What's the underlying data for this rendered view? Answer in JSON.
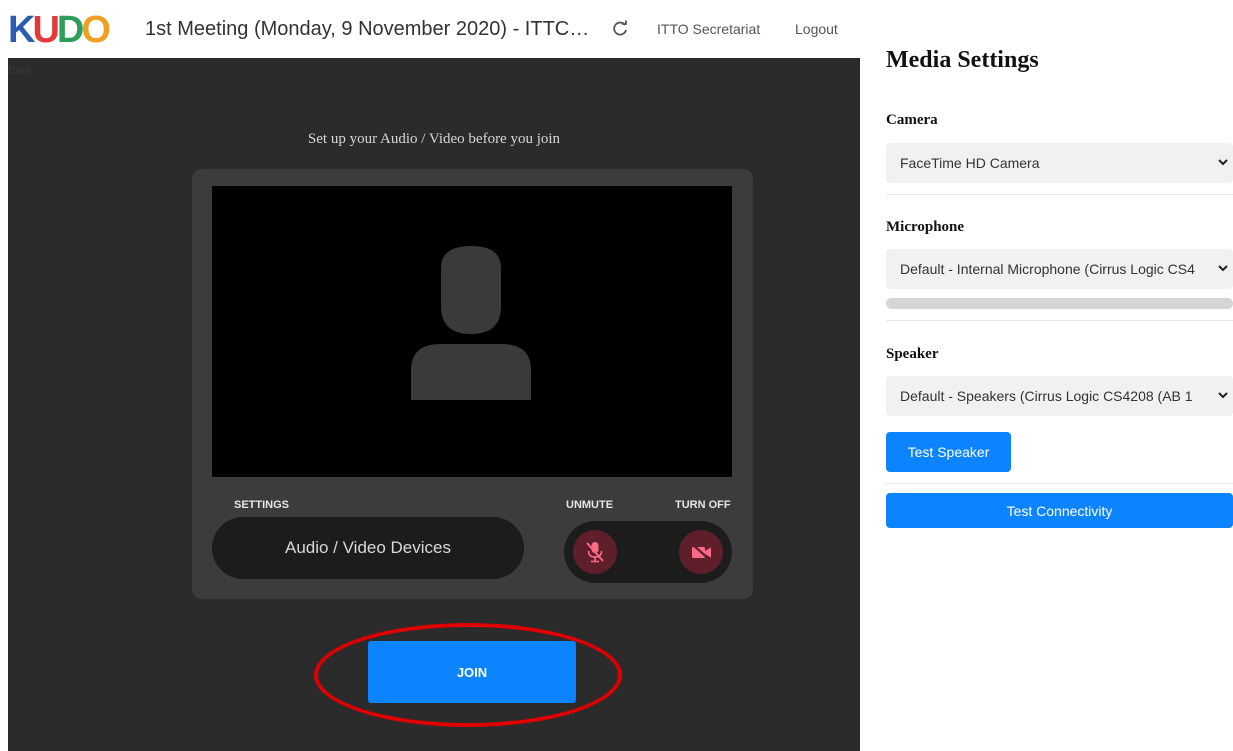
{
  "header": {
    "logo_letters": [
      {
        "char": "K",
        "color": "#2a5db0"
      },
      {
        "char": "U",
        "color": "#e23a3a"
      },
      {
        "char": "D",
        "color": "#2f9e5a"
      },
      {
        "char": "O",
        "color": "#f0a020"
      }
    ],
    "meeting_title": "1st Meeting (Monday, 9 November 2020) - ITTC…",
    "refresh_icon": "refresh-icon",
    "user_name": "ITTO Secretariat",
    "logout_label": "Logout"
  },
  "main": {
    "back_hint": "Back",
    "setup_text": "Set up your Audio / Video before you join",
    "avatar_icon": "person-silhouette-icon",
    "settings_label": "SETTINGS",
    "devices_button_label": "Audio / Video Devices",
    "unmute_label": "UNMUTE",
    "turnoff_label": "TURN OFF",
    "mic_icon": "microphone-muted-icon",
    "camera_icon": "camera-off-icon",
    "join_label": "JOIN",
    "highlight_color": "#e00000"
  },
  "media_settings": {
    "title": "Media Settings",
    "camera_label": "Camera",
    "camera_value": "FaceTime HD Camera",
    "microphone_label": "Microphone",
    "microphone_value": "Default - Internal Microphone (Cirrus Logic CS4",
    "mic_level": 0,
    "speaker_label": "Speaker",
    "speaker_value": "Default - Speakers (Cirrus Logic CS4208 (AB 1",
    "test_speaker_label": "Test Speaker",
    "test_connectivity_label": "Test Connectivity",
    "accent_color": "#0d84ff"
  }
}
